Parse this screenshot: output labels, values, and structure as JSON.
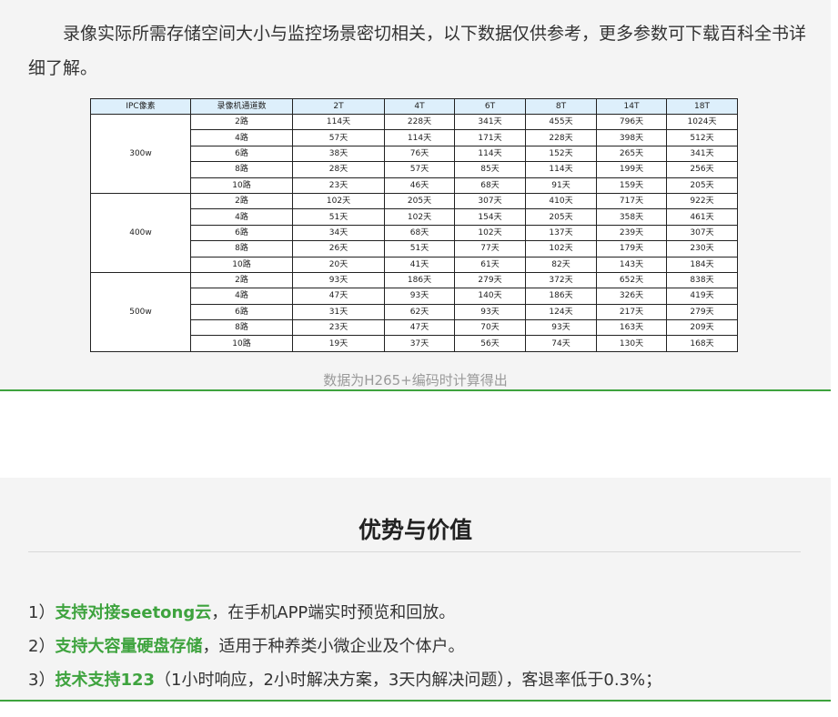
{
  "intro": "录像实际所需存储空间大小与监控场景密切相关，以下数据仅供参考，更多参数可下载百科全书详细了解。",
  "table": {
    "headers": [
      "IPC像素",
      "录像机通道数",
      "2T",
      "4T",
      "6T",
      "8T",
      "14T",
      "18T"
    ],
    "groups": [
      {
        "pixel": "300w",
        "rows": [
          {
            "channels": "2路",
            "values": [
              "114天",
              "228天",
              "341天",
              "455天",
              "796天",
              "1024天"
            ]
          },
          {
            "channels": "4路",
            "values": [
              "57天",
              "114天",
              "171天",
              "228天",
              "398天",
              "512天"
            ]
          },
          {
            "channels": "6路",
            "values": [
              "38天",
              "76天",
              "114天",
              "152天",
              "265天",
              "341天"
            ]
          },
          {
            "channels": "8路",
            "values": [
              "28天",
              "57天",
              "85天",
              "114天",
              "199天",
              "256天"
            ]
          },
          {
            "channels": "10路",
            "values": [
              "23天",
              "46天",
              "68天",
              "91天",
              "159天",
              "205天"
            ]
          }
        ]
      },
      {
        "pixel": "400w",
        "rows": [
          {
            "channels": "2路",
            "values": [
              "102天",
              "205天",
              "307天",
              "410天",
              "717天",
              "922天"
            ]
          },
          {
            "channels": "4路",
            "values": [
              "51天",
              "102天",
              "154天",
              "205天",
              "358天",
              "461天"
            ]
          },
          {
            "channels": "6路",
            "values": [
              "34天",
              "68天",
              "102天",
              "137天",
              "239天",
              "307天"
            ]
          },
          {
            "channels": "8路",
            "values": [
              "26天",
              "51天",
              "77天",
              "102天",
              "179天",
              "230天"
            ]
          },
          {
            "channels": "10路",
            "values": [
              "20天",
              "41天",
              "61天",
              "82天",
              "143天",
              "184天"
            ]
          }
        ]
      },
      {
        "pixel": "500w",
        "rows": [
          {
            "channels": "2路",
            "values": [
              "93天",
              "186天",
              "279天",
              "372天",
              "652天",
              "838天"
            ]
          },
          {
            "channels": "4路",
            "values": [
              "47天",
              "93天",
              "140天",
              "186天",
              "326天",
              "419天"
            ]
          },
          {
            "channels": "6路",
            "values": [
              "31天",
              "62天",
              "93天",
              "124天",
              "217天",
              "279天"
            ]
          },
          {
            "channels": "8路",
            "values": [
              "23天",
              "47天",
              "70天",
              "93天",
              "163天",
              "209天"
            ]
          },
          {
            "channels": "10路",
            "values": [
              "19天",
              "37天",
              "56天",
              "74天",
              "130天",
              "168天"
            ]
          }
        ]
      }
    ]
  },
  "caption": "数据为H265+编码时计算得出",
  "advantages": {
    "title": "优势与价值",
    "items": [
      {
        "prefix": "1）",
        "highlight": "支持对接seetong云",
        "rest": "，在手机APP端实时预览和回放。"
      },
      {
        "prefix": "2）",
        "highlight": "支持大容量硬盘存储",
        "rest": "，适用于种养类小微企业及个体户。"
      },
      {
        "prefix": "3）",
        "highlight": "技术支持123",
        "rest": "（1小时响应，2小时解决方案，3天内解决问题），客退率低于0.3%；"
      }
    ]
  },
  "colors": {
    "accent": "#3ea33e",
    "header_bg": "#ddeffb",
    "section_bg": "#f4f4f4"
  }
}
